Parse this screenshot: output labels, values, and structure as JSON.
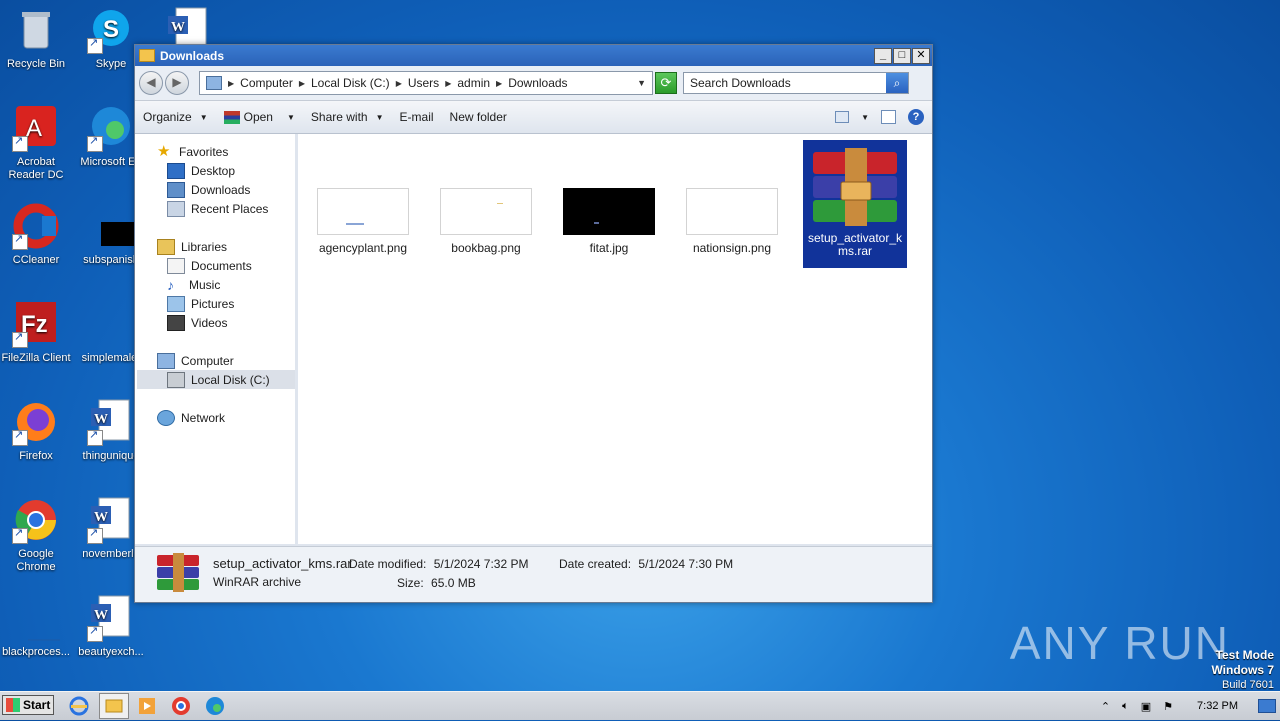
{
  "desktop": {
    "icons": [
      {
        "label": "Recycle Bin"
      },
      {
        "label": "Skype"
      },
      {
        "label": "Acrobat Reader DC"
      },
      {
        "label": "Microsoft Ed"
      },
      {
        "label": "CCleaner"
      },
      {
        "label": "subspanish"
      },
      {
        "label": "FileZilla Client"
      },
      {
        "label": "simplemale."
      },
      {
        "label": "Firefox"
      },
      {
        "label": "thingunique"
      },
      {
        "label": "Google Chrome"
      },
      {
        "label": "novemberlo"
      },
      {
        "label": "blackproces..."
      },
      {
        "label": "beautyexch..."
      }
    ],
    "watermark": "ANY RUN",
    "test_mode": {
      "line1": "Test Mode",
      "line2": "Windows 7",
      "line3": "Build 7601"
    }
  },
  "window": {
    "title": "Downloads",
    "breadcrumb": [
      "Computer",
      "Local Disk (C:)",
      "Users",
      "admin",
      "Downloads"
    ],
    "search_placeholder": "Search Downloads",
    "toolbar": {
      "organize": "Organize",
      "open": "Open",
      "share_with": "Share with",
      "email": "E-mail",
      "new_folder": "New folder"
    },
    "nav": {
      "favorites": "Favorites",
      "desktop": "Desktop",
      "downloads": "Downloads",
      "recent_places": "Recent Places",
      "libraries": "Libraries",
      "documents": "Documents",
      "music": "Music",
      "pictures": "Pictures",
      "videos": "Videos",
      "computer": "Computer",
      "local_disk": "Local Disk (C:)",
      "network": "Network"
    },
    "files": [
      {
        "name": "agencyplant.png"
      },
      {
        "name": "bookbag.png"
      },
      {
        "name": "fitat.jpg"
      },
      {
        "name": "nationsign.png"
      },
      {
        "name": "setup_activator_kms.rar"
      }
    ],
    "details": {
      "filename": "setup_activator_kms.rar",
      "type": "WinRAR archive",
      "modified_label": "Date modified:",
      "modified_value": "5/1/2024 7:32 PM",
      "created_label": "Date created:",
      "created_value": "5/1/2024 7:30 PM",
      "size_label": "Size:",
      "size_value": "65.0 MB"
    }
  },
  "taskbar": {
    "start": "Start",
    "clock": "7:32 PM"
  }
}
